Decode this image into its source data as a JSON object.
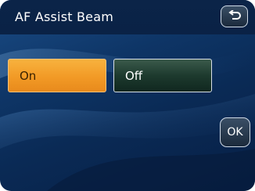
{
  "header": {
    "title": "AF Assist Beam"
  },
  "toolbar": {
    "back_icon": "return-arrow-icon"
  },
  "options": [
    {
      "label": "On",
      "selected": true
    },
    {
      "label": "Off",
      "selected": false
    }
  ],
  "actions": {
    "ok_label": "OK"
  },
  "colors": {
    "selected_accent": "#f29a26",
    "background": "#0e3566"
  }
}
